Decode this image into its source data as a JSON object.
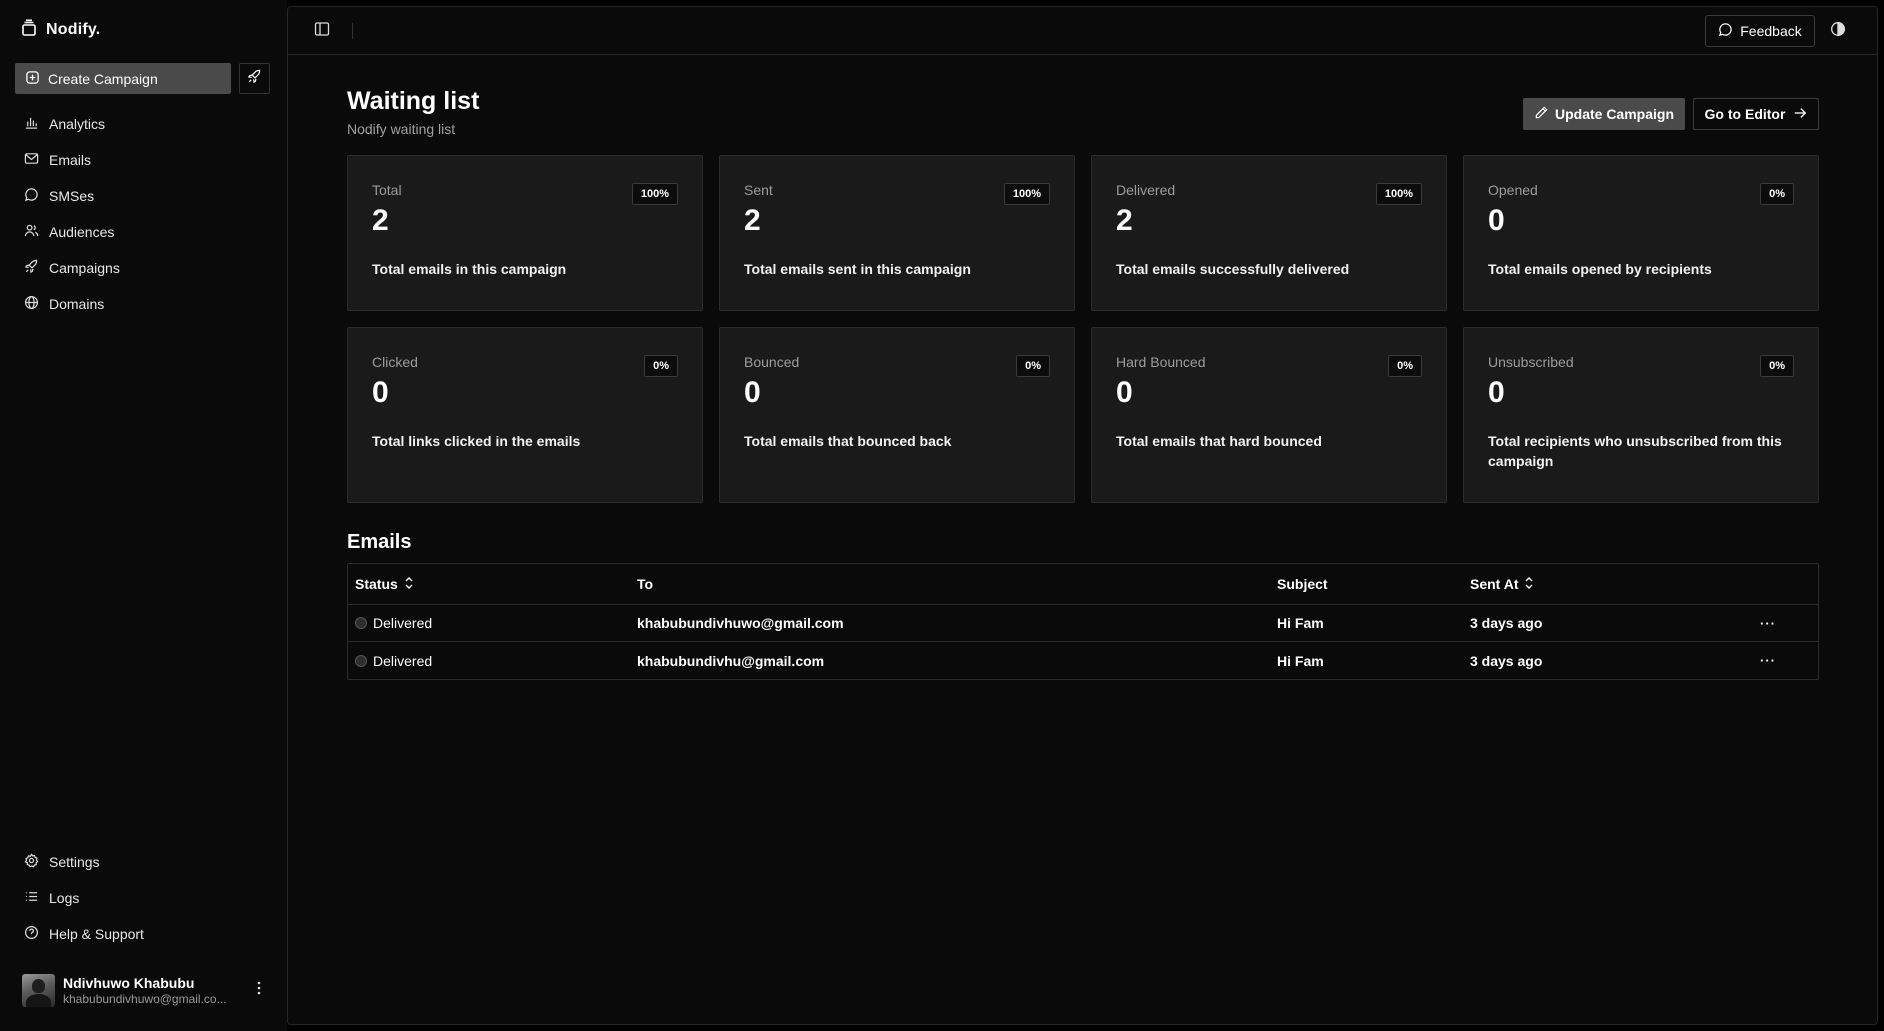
{
  "brand": {
    "name": "Nodify."
  },
  "sidebar": {
    "create_label": "Create Campaign",
    "nav_top": [
      {
        "label": "Analytics",
        "icon": "bar-chart-icon"
      },
      {
        "label": "Emails",
        "icon": "mail-icon"
      },
      {
        "label": "SMSes",
        "icon": "message-icon"
      },
      {
        "label": "Audiences",
        "icon": "users-icon"
      },
      {
        "label": "Campaigns",
        "icon": "rocket-icon"
      },
      {
        "label": "Domains",
        "icon": "globe-icon"
      }
    ],
    "nav_bottom": [
      {
        "label": "Settings",
        "icon": "gear-icon"
      },
      {
        "label": "Logs",
        "icon": "list-icon"
      },
      {
        "label": "Help & Support",
        "icon": "help-icon"
      }
    ],
    "user": {
      "name": "Ndivhuwo Khabubu",
      "email": "khabubundivhuwo@gmail.co..."
    }
  },
  "topbar": {
    "feedback_label": "Feedback"
  },
  "page": {
    "title": "Waiting list",
    "subtitle": "Nodify waiting list",
    "update_label": "Update Campaign",
    "editor_label": "Go to Editor"
  },
  "stats": [
    {
      "label": "Total",
      "value": "2",
      "percent": "100%",
      "desc": "Total emails in this campaign"
    },
    {
      "label": "Sent",
      "value": "2",
      "percent": "100%",
      "desc": "Total emails sent in this campaign"
    },
    {
      "label": "Delivered",
      "value": "2",
      "percent": "100%",
      "desc": "Total emails successfully delivered"
    },
    {
      "label": "Opened",
      "value": "0",
      "percent": "0%",
      "desc": "Total emails opened by recipients"
    },
    {
      "label": "Clicked",
      "value": "0",
      "percent": "0%",
      "desc": "Total links clicked in the emails"
    },
    {
      "label": "Bounced",
      "value": "0",
      "percent": "0%",
      "desc": "Total emails that bounced back"
    },
    {
      "label": "Hard Bounced",
      "value": "0",
      "percent": "0%",
      "desc": "Total emails that hard bounced"
    },
    {
      "label": "Unsubscribed",
      "value": "0",
      "percent": "0%",
      "desc": "Total recipients who unsubscribed from this campaign"
    }
  ],
  "emails": {
    "title": "Emails",
    "columns": {
      "status": "Status",
      "to": "To",
      "subject": "Subject",
      "sent_at": "Sent At"
    },
    "rows": [
      {
        "status": "Delivered",
        "to": "khabubundivhuwo@gmail.com",
        "subject": "Hi Fam",
        "sent_at": "3 days ago",
        "actions": "···"
      },
      {
        "status": "Delivered",
        "to": "khabubundivhu@gmail.com",
        "subject": "Hi Fam",
        "sent_at": "3 days ago",
        "actions": "···"
      }
    ]
  }
}
